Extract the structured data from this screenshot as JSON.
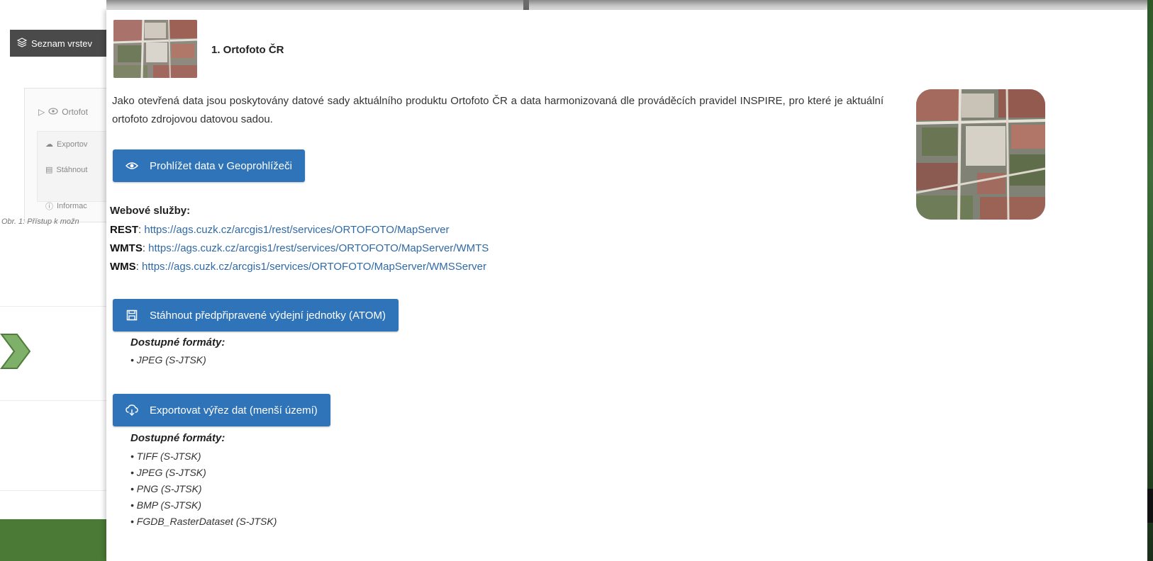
{
  "background": {
    "layers_button_label": "Seznam vrstev",
    "layer_row_label": "Ortofot",
    "sub_export_label": "Exportov",
    "sub_download_label": "Stáhnout",
    "sub_info_label": "Informac",
    "caption": "Obr. 1: Přístup k možn"
  },
  "modal": {
    "title": "1. Ortofoto ČR",
    "description": "Jako otevřená data jsou poskytovány datové sady aktuálního produktu Ortofoto ČR a data harmonizovaná dle prováděcích pravidel INSPIRE, pro které je aktuální ortofoto zdrojovou datovou sadou.",
    "view_button_label": "Prohlížet data v Geoprohlížeči",
    "web_services": {
      "heading": "Webové služby:",
      "items": [
        {
          "label": "REST",
          "url": "https://ags.cuzk.cz/arcgis1/rest/services/ORTOFOTO/MapServer"
        },
        {
          "label": "WMTS",
          "url": "https://ags.cuzk.cz/arcgis1/rest/services/ORTOFOTO/MapServer/WMTS"
        },
        {
          "label": "WMS",
          "url": "https://ags.cuzk.cz/arcgis1/services/ORTOFOTO/MapServer/WMSServer"
        }
      ]
    },
    "download_button_label": "Stáhnout předpřipravené výdejní jednotky (ATOM)",
    "download_formats": {
      "heading": "Dostupné formáty:",
      "items": [
        "• JPEG (S-JTSK)"
      ]
    },
    "export_button_label": "Exportovat výřez dat (menší území)",
    "export_formats": {
      "heading": "Dostupné formáty:",
      "items": [
        "• TIFF (S-JTSK)",
        "• JPEG (S-JTSK)",
        "• PNG (S-JTSK)",
        "• BMP (S-JTSK)",
        "• FGDB_RasterDataset (S-JTSK)"
      ]
    }
  },
  "colors": {
    "button_blue": "#2f73b8",
    "link_blue": "#2f6aa8",
    "green_bar": "#4b7a37",
    "arrow_green": "#7fb06a"
  }
}
